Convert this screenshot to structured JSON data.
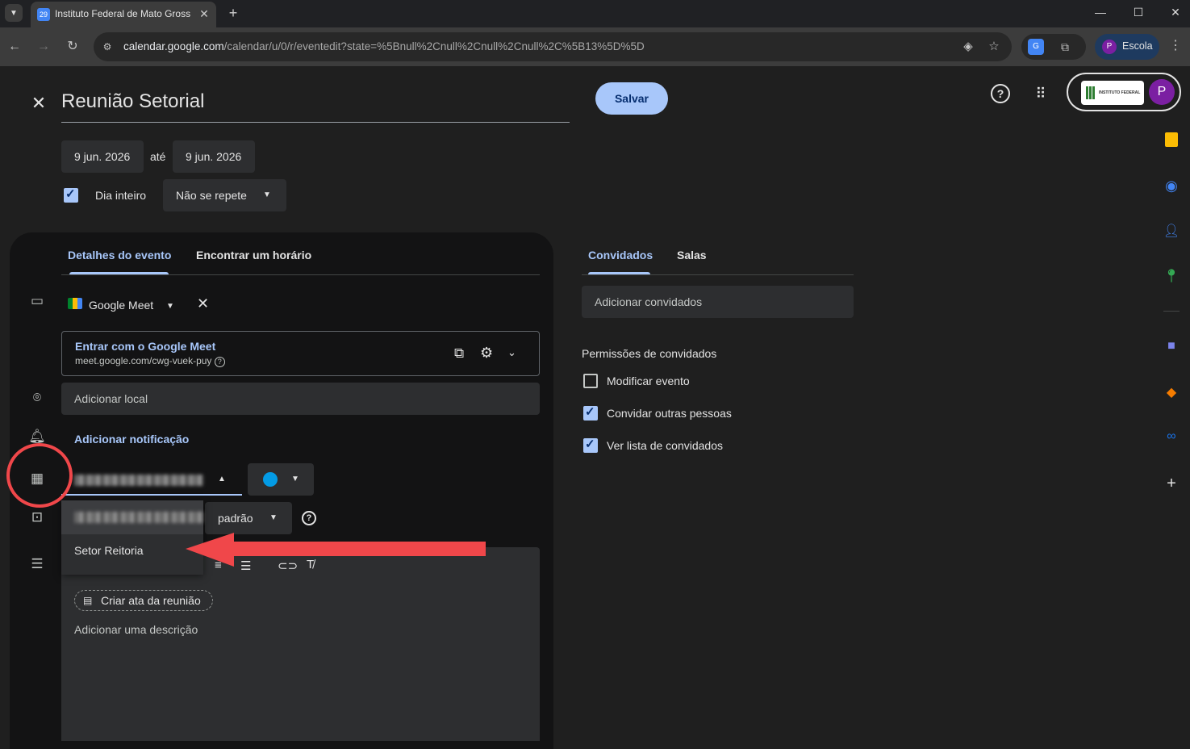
{
  "browser": {
    "tab_title": "Instituto Federal de Mato Grosso",
    "url_host": "calendar.google.com",
    "url_rest": "/calendar/u/0/r/eventedit?state=%5Bnull%2Cnull%2Cnull%2Cnull%2C%5B13%5D%5D",
    "profile_label": "Escola",
    "profile_initial": "P",
    "tab_favicon": "29"
  },
  "header": {
    "title": "Reunião Setorial",
    "save_label": "Salvar",
    "account_initial": "P",
    "org_logo_text": "INSTITUTO FEDERAL"
  },
  "dates": {
    "start": "9 jun. 2026",
    "until": "até",
    "end": "9 jun. 2026",
    "all_day_label": "Dia inteiro",
    "all_day_checked": true,
    "repeat": "Não se repete"
  },
  "details_tabs": [
    {
      "label": "Detalhes do evento",
      "active": true
    },
    {
      "label": "Encontrar um horário",
      "active": false
    }
  ],
  "meet": {
    "provider": "Google Meet",
    "join_label": "Entrar com o Google Meet",
    "link": "meet.google.com/cwg-vuek-puy"
  },
  "location_placeholder": "Adicionar local",
  "add_notification": "Adicionar notificação",
  "visibility_suffix": "padrão",
  "dropdown_option": "Setor Reitoria",
  "description": {
    "minutes_chip": "Criar ata da reunião",
    "placeholder": "Adicionar uma descrição"
  },
  "guests": {
    "tabs": [
      {
        "label": "Convidados",
        "active": true
      },
      {
        "label": "Salas",
        "active": false
      }
    ],
    "add_placeholder": "Adicionar convidados",
    "permissions_title": "Permissões de convidados",
    "permissions": [
      {
        "label": "Modificar evento",
        "checked": false
      },
      {
        "label": "Convidar outras pessoas",
        "checked": true
      },
      {
        "label": "Ver lista de convidados",
        "checked": true
      }
    ]
  },
  "colors": {
    "accent": "#a8c7fa",
    "event_color": "#039be5",
    "annotation": "#f0474a"
  }
}
